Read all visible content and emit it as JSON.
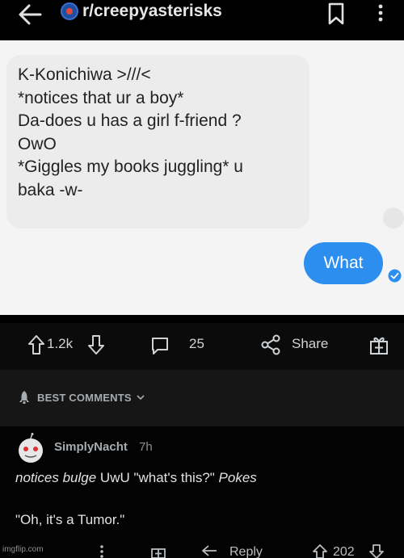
{
  "header": {
    "subreddit": "r/creepyasterisks",
    "back_icon": "arrow-left-icon",
    "bookmark_icon": "bookmark-icon",
    "more_icon": "more-vertical-icon"
  },
  "screenshot": {
    "left_message_lines": [
      "K-Konichiwa >///<",
      "*notices that ur a boy*",
      "Da-does u has a girl f-friend ?",
      "OwO",
      "*Giggles my books juggling* u",
      "baka -w-"
    ],
    "right_message": "What",
    "right_bubble_color": "#2c8ff0"
  },
  "post_actions": {
    "upvotes": "1.2k",
    "comments": "25",
    "share_label": "Share"
  },
  "comments_sort": {
    "label": "BEST COMMENTS"
  },
  "comment": {
    "username": "SimplyNacht",
    "time": "7h",
    "text_italic_1": "notices bulge",
    "text_normal_1": " UwU \"what's this?\" ",
    "text_italic_2": "Pokes",
    "text_line2": "\"Oh, it's a Tumor.\"",
    "reply_label": "Reply",
    "votes": "202"
  },
  "watermark": "imgflip.com"
}
